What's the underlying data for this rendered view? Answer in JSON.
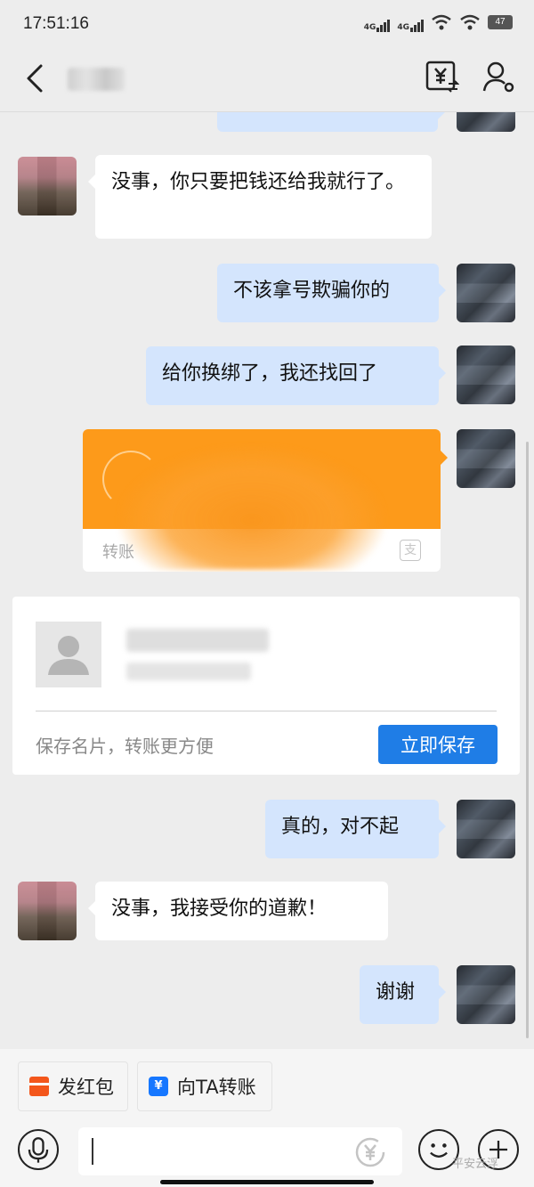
{
  "status_bar": {
    "time": "17:51:16",
    "net1": "4G",
    "net2": "4G",
    "battery": "47"
  },
  "header": {
    "icons": [
      "back-icon",
      "yen-transfer-icon",
      "contact-icon"
    ]
  },
  "messages": [
    {
      "from": "peer",
      "text": "没事，你只要把钱还给我就行了。"
    },
    {
      "from": "me",
      "text": "不该拿号欺骗你的"
    },
    {
      "from": "me",
      "text": "给你换绑了，我还找回了"
    },
    {
      "from": "me",
      "text": "真的，对不起"
    },
    {
      "from": "peer",
      "text": "没事，我接受你的道歉！"
    },
    {
      "from": "me",
      "text": "谢谢"
    }
  ],
  "transfer": {
    "label": "转账"
  },
  "contact_card": {
    "hint": "保存名片，转账更方便",
    "save_label": "立即保存"
  },
  "quick_actions": {
    "red_packet": "发红包",
    "transfer_to_ta": "向TA转账"
  },
  "input": {
    "placeholder": ""
  },
  "watermark": "平安云浮",
  "colors": {
    "me_bubble": "#d4e5fd",
    "peer_bubble": "#ffffff",
    "transfer": "#fd9a1a",
    "save_button": "#1f7de6"
  }
}
